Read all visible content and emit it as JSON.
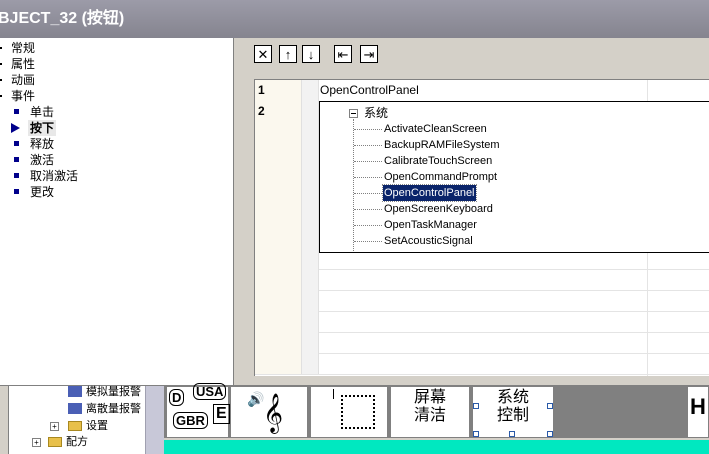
{
  "window": {
    "title": "BJECT_32 (按钮)"
  },
  "left_tree": {
    "items": [
      {
        "label": "常规"
      },
      {
        "label": "属性"
      },
      {
        "label": "动画"
      },
      {
        "label": "事件"
      }
    ],
    "event_children": [
      {
        "label": "单击"
      },
      {
        "label": "按下",
        "active": true
      },
      {
        "label": "释放"
      },
      {
        "label": "激活"
      },
      {
        "label": "取消激活"
      },
      {
        "label": "更改"
      }
    ]
  },
  "toolbar": {
    "delete_glyph": "✕",
    "up_glyph": "↑",
    "down_glyph": "↓",
    "outdent_glyph": "⇤",
    "indent_glyph": "⇥"
  },
  "function_list": {
    "rows": [
      {
        "num": "1",
        "value": "OpenControlPanel"
      },
      {
        "num": "2",
        "value": ""
      }
    ]
  },
  "dropdown": {
    "root_label": "系统",
    "items": [
      {
        "label": "ActivateCleanScreen"
      },
      {
        "label": "BackupRAMFileSystem"
      },
      {
        "label": "CalibrateTouchScreen"
      },
      {
        "label": "OpenCommandPrompt"
      },
      {
        "label": "OpenControlPanel",
        "selected": true
      },
      {
        "label": "OpenScreenKeyboard"
      },
      {
        "label": "OpenTaskManager"
      },
      {
        "label": "SetAcousticSignal"
      }
    ]
  },
  "project_tree": {
    "items": [
      {
        "label": "模拟量报警"
      },
      {
        "label": "离散量报警"
      },
      {
        "label": "设置"
      },
      {
        "label": "配方"
      }
    ]
  },
  "screen_tiles": {
    "lang_tile": {
      "top": "USA",
      "left": "D",
      "bottom": "GBR",
      "right": "E"
    },
    "clean_screen": {
      "line1": "屏幕",
      "line2": "清洁"
    },
    "system_control": {
      "line1": "系统",
      "line2": "控制"
    },
    "partial_letter": "H"
  },
  "colors": {
    "titlebar": "#8d8c98",
    "selection": "#0a246a",
    "accent_cyan": "#00e8c0",
    "bullet": "#00008b"
  }
}
